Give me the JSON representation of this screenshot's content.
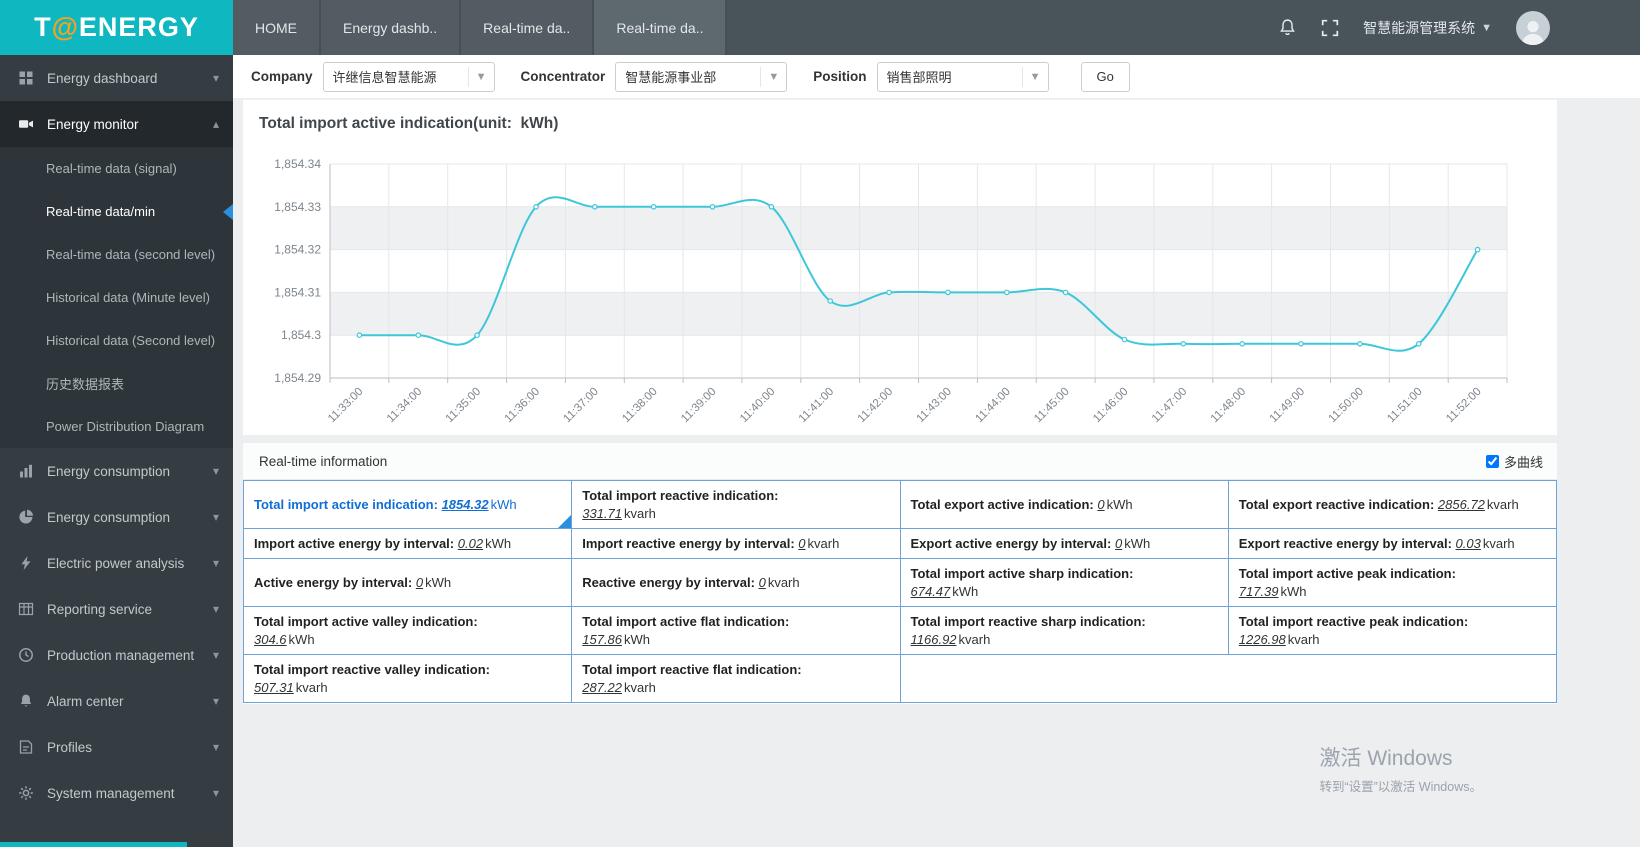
{
  "logo": {
    "text_t": "T",
    "text_at": "@",
    "text_energy": "ENERGY"
  },
  "topnav": {
    "tabs": [
      {
        "label": "HOME",
        "active": false
      },
      {
        "label": "Energy dashb..",
        "active": false
      },
      {
        "label": "Real-time da..",
        "active": false
      },
      {
        "label": "Real-time da..",
        "active": true
      }
    ],
    "system_title": "智慧能源管理系统"
  },
  "sidebar": {
    "items": [
      {
        "label": "Energy dashboard",
        "icon": "dashboard-icon",
        "expandable": true
      },
      {
        "label": "Energy monitor",
        "icon": "monitor-icon",
        "expandable": true,
        "active": true,
        "expanded": true,
        "children": [
          {
            "label": "Real-time data (signal)"
          },
          {
            "label": "Real-time data/min",
            "selected": true
          },
          {
            "label": "Real-time data (second level)"
          },
          {
            "label": "Historical data (Minute level)"
          },
          {
            "label": "Historical data (Second level)"
          },
          {
            "label": "历史数据报表"
          },
          {
            "label": "Power Distribution Diagram"
          }
        ]
      },
      {
        "label": "Energy consumption",
        "icon": "energy-consumption-icon",
        "expandable": true
      },
      {
        "label": "Energy consumption",
        "icon": "energy-consumption-alt-icon",
        "expandable": true
      },
      {
        "label": "Electric power analysis",
        "icon": "electric-power-icon",
        "expandable": true
      },
      {
        "label": "Reporting service",
        "icon": "reporting-icon",
        "expandable": true
      },
      {
        "label": "Production management",
        "icon": "production-icon",
        "expandable": true
      },
      {
        "label": "Alarm center",
        "icon": "alarm-bell-icon",
        "expandable": true
      },
      {
        "label": "Profiles",
        "icon": "profiles-icon",
        "expandable": true
      },
      {
        "label": "System management",
        "icon": "system-gear-icon",
        "expandable": true
      }
    ]
  },
  "filters": {
    "company_label": "Company",
    "company_value": "许继信息智慧能源",
    "concentrator_label": "Concentrator",
    "concentrator_value": "智慧能源事业部",
    "position_label": "Position",
    "position_value": "销售部照明",
    "go_label": "Go"
  },
  "chart_panel": {
    "title": "Total import active indication(unit:  kWh)"
  },
  "chart_data": {
    "type": "line",
    "title": "Total import active indication(unit: kWh)",
    "xlabel": "",
    "ylabel": "",
    "grid": true,
    "legend_position": "none",
    "line_color": "#3ec7d8",
    "ylim": [
      1854.29,
      1854.34
    ],
    "yticks": [
      {
        "v": 1854.29,
        "label": "1,854.29"
      },
      {
        "v": 1854.3,
        "label": "1,854.3"
      },
      {
        "v": 1854.31,
        "label": "1,854.31"
      },
      {
        "v": 1854.32,
        "label": "1,854.32"
      },
      {
        "v": 1854.33,
        "label": "1,854.33"
      },
      {
        "v": 1854.34,
        "label": "1,854.34"
      }
    ],
    "x": [
      "11:33:00",
      "11:34:00",
      "11:35:00",
      "11:36:00",
      "11:37:00",
      "11:38:00",
      "11:39:00",
      "11:40:00",
      "11:41:00",
      "11:42:00",
      "11:43:00",
      "11:44:00",
      "11:45:00",
      "11:46:00",
      "11:47:00",
      "11:48:00",
      "11:49:00",
      "11:50:00",
      "11:51:00",
      "11:52:00"
    ],
    "series": [
      {
        "name": "Total import active indication",
        "values": [
          1854.3,
          1854.3,
          1854.3,
          1854.33,
          1854.33,
          1854.33,
          1854.33,
          1854.33,
          1854.308,
          1854.31,
          1854.31,
          1854.31,
          1854.31,
          1854.299,
          1854.298,
          1854.298,
          1854.298,
          1854.298,
          1854.298,
          1854.32
        ]
      }
    ]
  },
  "realtime": {
    "header": "Real-time information",
    "multi_curve_label": "多曲线",
    "multi_curve_checked": true,
    "rows": [
      [
        {
          "label": "Total import active indication:",
          "value": "1854.32",
          "unit": "kWh",
          "inline": true,
          "active": true
        },
        {
          "label": "Total import reactive indication:",
          "value": "331.71",
          "unit": "kvarh",
          "inline": false
        },
        {
          "label": "Total export active indication:",
          "value": "0",
          "unit": "kWh",
          "inline": true
        },
        {
          "label": "Total export reactive indication:",
          "value": "2856.72",
          "unit": "kvarh",
          "inline": true
        }
      ],
      [
        {
          "label": "Import active energy by interval:",
          "value": "0.02",
          "unit": "kWh",
          "inline": true
        },
        {
          "label": "Import reactive energy by interval:",
          "value": "0",
          "unit": "kvarh",
          "inline": true
        },
        {
          "label": "Export active energy by interval:",
          "value": "0",
          "unit": "kWh",
          "inline": true
        },
        {
          "label": "Export reactive energy by interval:",
          "value": "0.03",
          "unit": "kvarh",
          "inline": true
        }
      ],
      [
        {
          "label": "Active energy by interval:",
          "value": "0",
          "unit": "kWh",
          "inline": true
        },
        {
          "label": "Reactive energy by interval:",
          "value": "0",
          "unit": "kvarh",
          "inline": true
        },
        {
          "label": "Total import active sharp indication:",
          "value": "674.47",
          "unit": "kWh",
          "inline": false
        },
        {
          "label": "Total import active peak indication:",
          "value": "717.39",
          "unit": "kWh",
          "inline": false
        }
      ],
      [
        {
          "label": "Total import active valley indication:",
          "value": "304.6",
          "unit": "kWh",
          "inline": false
        },
        {
          "label": "Total import active flat indication:",
          "value": "157.86",
          "unit": "kWh",
          "inline": false
        },
        {
          "label": "Total import reactive sharp indication:",
          "value": "1166.92",
          "unit": "kvarh",
          "inline": false
        },
        {
          "label": "Total import reactive peak indication:",
          "value": "1226.98",
          "unit": "kvarh",
          "inline": false
        }
      ],
      [
        {
          "label": "Total import reactive valley indication:",
          "value": "507.31",
          "unit": "kvarh",
          "inline": false
        },
        {
          "label": "Total import reactive flat indication:",
          "value": "287.22",
          "unit": "kvarh",
          "inline": false
        },
        {
          "empty": true,
          "span": 2
        }
      ]
    ]
  },
  "watermark": {
    "line1": "激活 Windows",
    "line2": "转到“设置”以激活 Windows。"
  }
}
